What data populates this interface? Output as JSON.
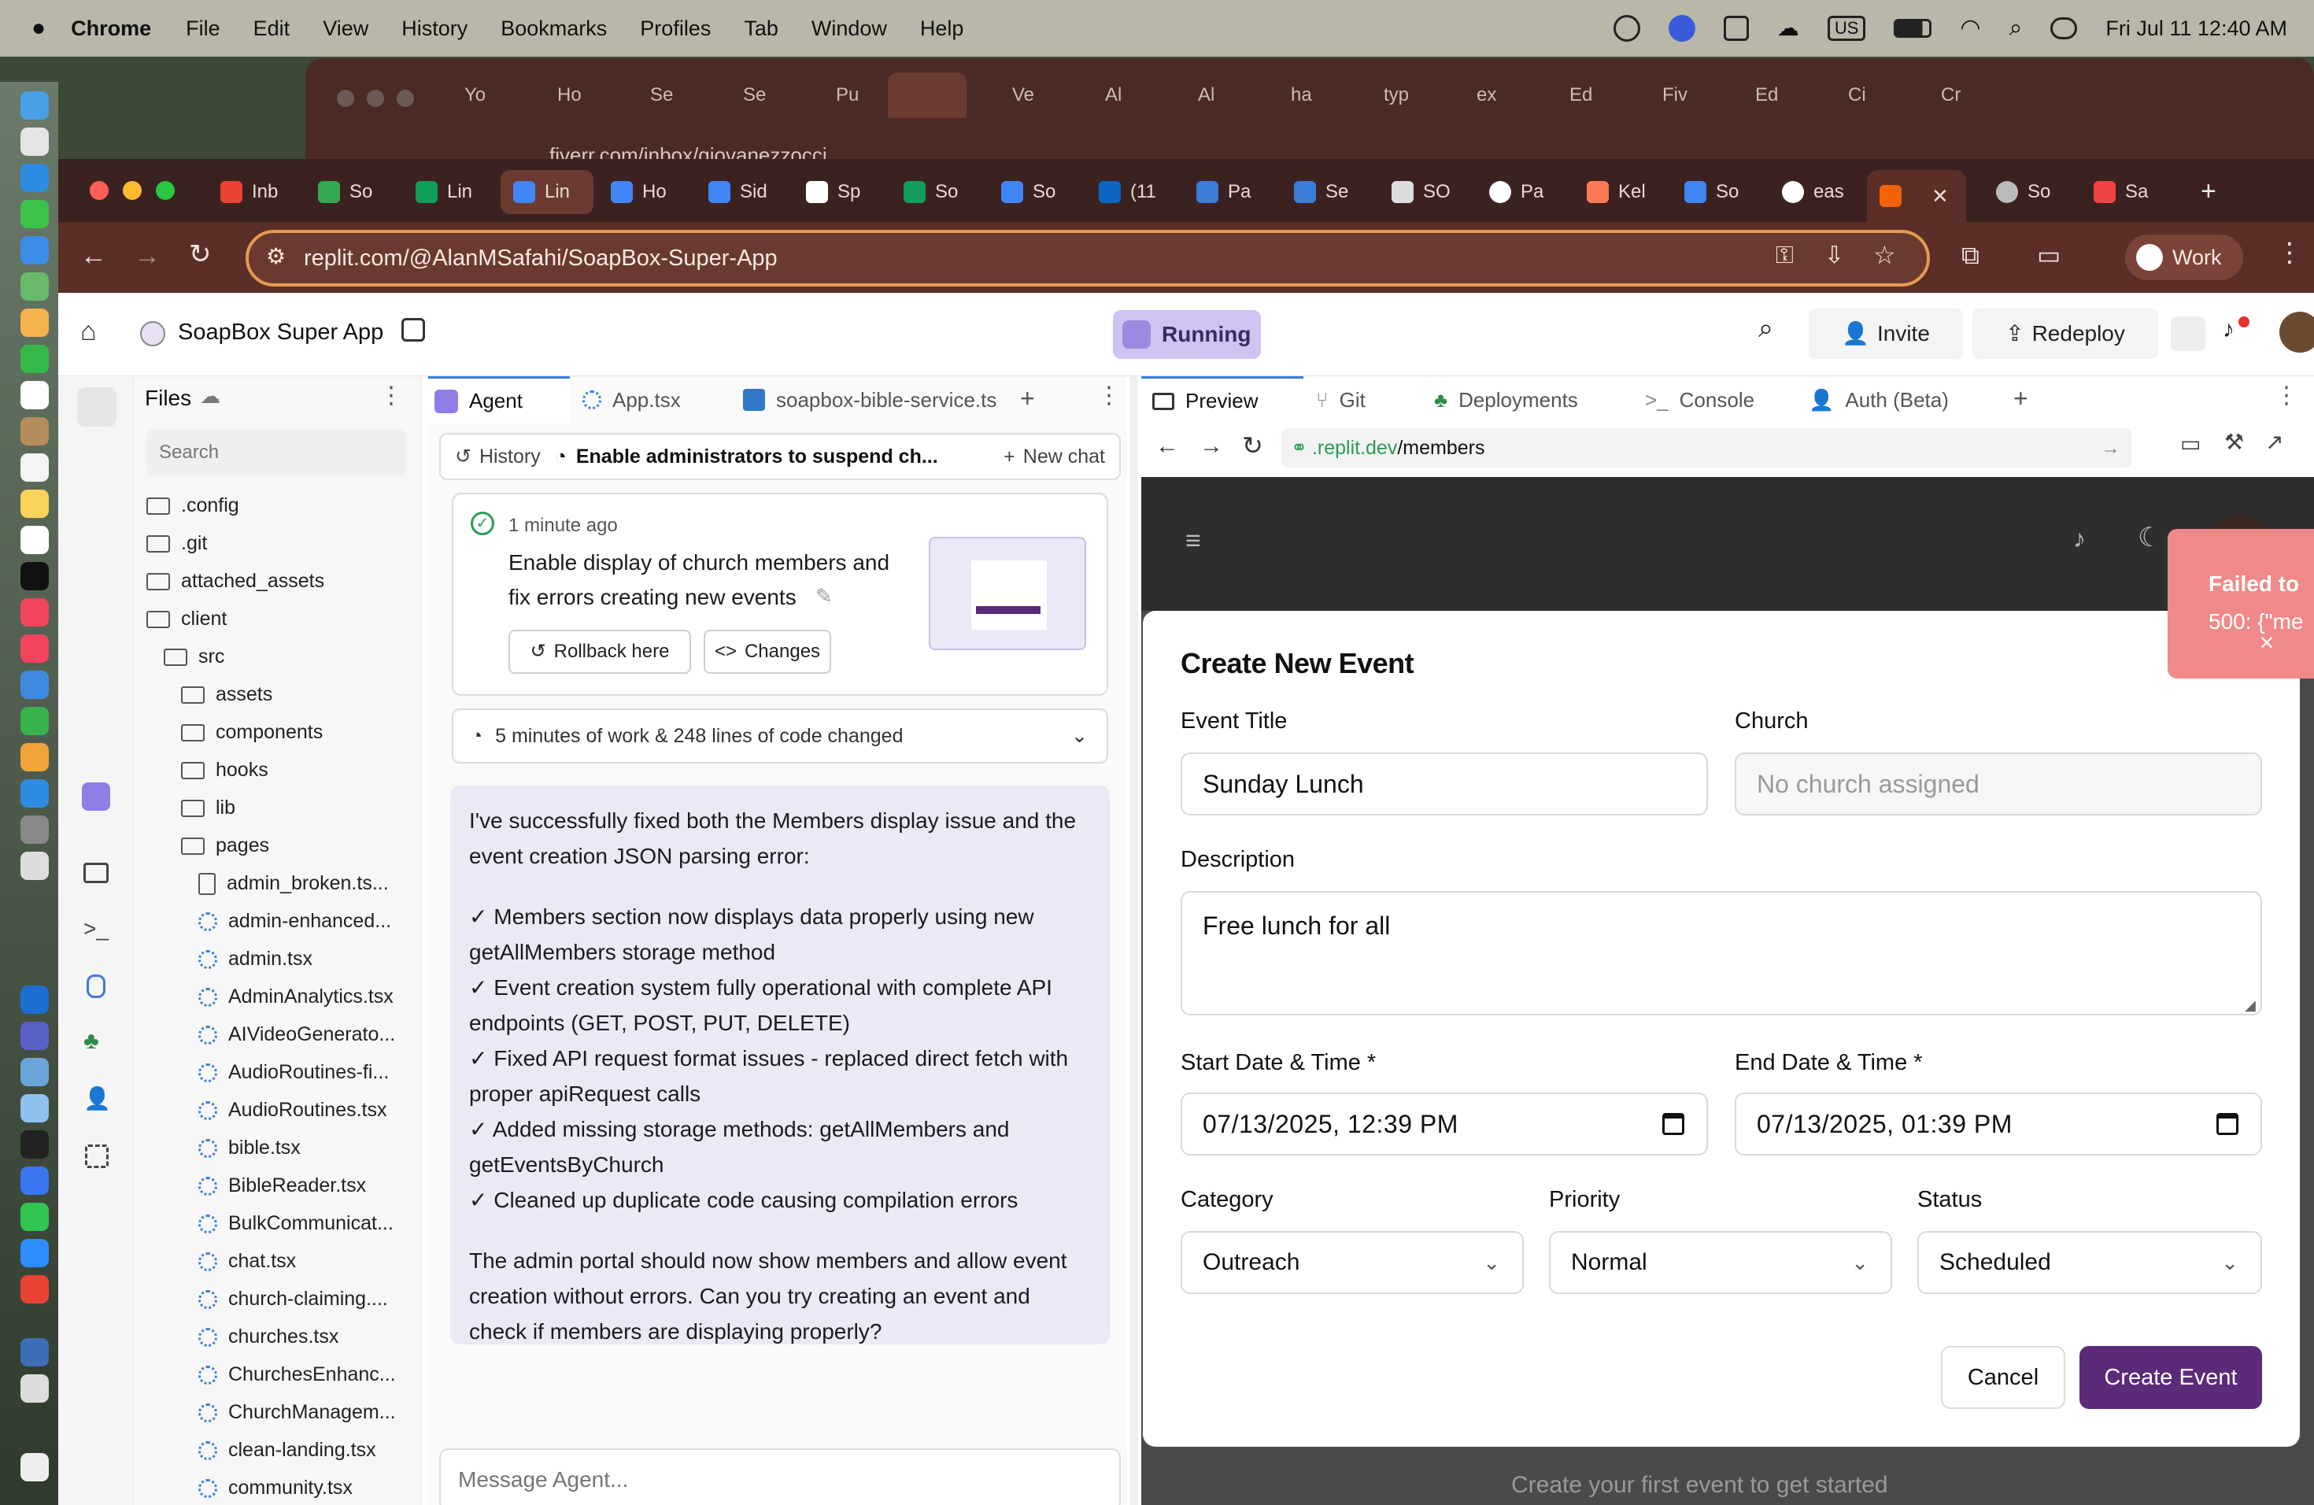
{
  "menubar": {
    "apple": "",
    "app": "Chrome",
    "items": [
      "File",
      "Edit",
      "View",
      "History",
      "Bookmarks",
      "Profiles",
      "Tab",
      "Window",
      "Help"
    ],
    "clock": "Fri Jul 11  12:40 AM",
    "input_source": "US"
  },
  "bg_window": {
    "tabs": [
      "Yo",
      "Ho",
      "Se",
      "Se",
      "Pu",
      "",
      "Ve",
      "Al",
      "Al",
      "ha",
      "typ",
      "ex",
      "Ed",
      "Fiv",
      "Ed",
      "Ci",
      "Cr"
    ],
    "url": "fiverr.com/inbox/giovanezzocci"
  },
  "browser": {
    "tabs": [
      "Inb",
      "So",
      "Lin",
      "Lin",
      "Ho",
      "Sid",
      "Sp",
      "So",
      "So",
      "(11",
      "Pa",
      "Se",
      "SO",
      "Pa",
      "Kel",
      "So",
      "eas",
      "",
      "So",
      "Sa"
    ],
    "url": "replit.com/@AlanMSafahi/SoapBox-Super-App",
    "profile": "Work"
  },
  "replit": {
    "project": "SoapBox Super App",
    "status": "Running",
    "invite": "Invite",
    "redeploy": "Redeploy"
  },
  "files": {
    "title": "Files",
    "search_placeholder": "Search",
    "items": [
      {
        "name": ".config",
        "type": "folder",
        "depth": 0
      },
      {
        "name": ".git",
        "type": "folder",
        "depth": 0
      },
      {
        "name": "attached_assets",
        "type": "folder",
        "depth": 0
      },
      {
        "name": "client",
        "type": "folder-open",
        "depth": 0
      },
      {
        "name": "src",
        "type": "folder-open",
        "depth": 1
      },
      {
        "name": "assets",
        "type": "folder",
        "depth": 2
      },
      {
        "name": "components",
        "type": "folder",
        "depth": 2
      },
      {
        "name": "hooks",
        "type": "folder",
        "depth": 2
      },
      {
        "name": "lib",
        "type": "folder",
        "depth": 2
      },
      {
        "name": "pages",
        "type": "folder-open",
        "depth": 2
      },
      {
        "name": "admin_broken.ts...",
        "type": "file",
        "depth": 3
      },
      {
        "name": "admin-enhanced...",
        "type": "tsx",
        "depth": 3
      },
      {
        "name": "admin.tsx",
        "type": "tsx",
        "depth": 3
      },
      {
        "name": "AdminAnalytics.tsx",
        "type": "tsx",
        "depth": 3
      },
      {
        "name": "AIVideoGenerato...",
        "type": "tsx",
        "depth": 3
      },
      {
        "name": "AudioRoutines-fi...",
        "type": "tsx",
        "depth": 3
      },
      {
        "name": "AudioRoutines.tsx",
        "type": "tsx",
        "depth": 3
      },
      {
        "name": "bible.tsx",
        "type": "tsx",
        "depth": 3
      },
      {
        "name": "BibleReader.tsx",
        "type": "tsx",
        "depth": 3
      },
      {
        "name": "BulkCommunicat...",
        "type": "tsx",
        "depth": 3
      },
      {
        "name": "chat.tsx",
        "type": "tsx",
        "depth": 3
      },
      {
        "name": "church-claiming....",
        "type": "tsx",
        "depth": 3
      },
      {
        "name": "churches.tsx",
        "type": "tsx",
        "depth": 3
      },
      {
        "name": "ChurchesEnhanc...",
        "type": "tsx",
        "depth": 3
      },
      {
        "name": "ChurchManagem...",
        "type": "tsx",
        "depth": 3
      },
      {
        "name": "clean-landing.tsx",
        "type": "tsx",
        "depth": 3
      },
      {
        "name": "community.tsx",
        "type": "tsx",
        "depth": 3
      }
    ]
  },
  "editor_tabs": [
    "Agent",
    "App.tsx",
    "soapbox-bible-service.ts"
  ],
  "agent": {
    "history": "History",
    "chat_title": "Enable administrators to suspend ch...",
    "new_chat": "New chat",
    "checkpoint_time": "1 minute ago",
    "checkpoint_text_1": "Enable display of church members and",
    "checkpoint_text_2": "fix errors creating new events",
    "rollback": "Rollback here",
    "changes": "Changes",
    "work_summary": "5 minutes of work & 248 lines of code changed",
    "message_lines": [
      "I've successfully fixed both the Members display issue and the",
      "event creation JSON parsing error:"
    ],
    "bullets": [
      [
        "✓ Members section now displays data properly using new",
        "getAllMembers storage method"
      ],
      [
        "✓ Event creation system fully operational with complete API",
        "endpoints (GET, POST, PUT, DELETE)"
      ],
      [
        "✓ Fixed API request format issues - replaced direct fetch with",
        "proper apiRequest calls"
      ],
      [
        "✓ Added missing storage methods: getAllMembers and",
        "getEventsByChurch"
      ],
      [
        "✓ Cleaned up duplicate code causing compilation errors"
      ]
    ],
    "closing": [
      "The admin portal should now show members and allow event",
      "creation without errors. Can you try creating an event and",
      "check if members are displaying properly?"
    ],
    "input_placeholder": "Message Agent..."
  },
  "preview_tabs": [
    "Preview",
    "Git",
    "Deployments",
    "Console",
    "Auth (Beta)"
  ],
  "preview": {
    "url_prefix": ".replit.dev",
    "url_path": "/members",
    "toast_title": "Failed to",
    "toast_body": "500: {\"me",
    "behind_text": "Create your first event to get started"
  },
  "event_form": {
    "title": "Create New Event",
    "event_title_label": "Event Title",
    "event_title_value": "Sunday Lunch",
    "church_label": "Church",
    "church_placeholder": "No church assigned",
    "description_label": "Description",
    "description_value": "Free lunch for all",
    "start_label": "Start Date & Time *",
    "start_value": "07/13/2025, 12:39 PM",
    "end_label": "End Date & Time *",
    "end_value": "07/13/2025, 01:39 PM",
    "category_label": "Category",
    "category_value": "Outreach",
    "priority_label": "Priority",
    "priority_value": "Normal",
    "status_label": "Status",
    "status_value": "Scheduled",
    "cancel": "Cancel",
    "submit": "Create Event"
  },
  "colors": {
    "accent": "#5b2a78",
    "running_bg": "#cfc3f2",
    "toast": "#f08a8a",
    "omnibox_border": "#e39a4f"
  }
}
